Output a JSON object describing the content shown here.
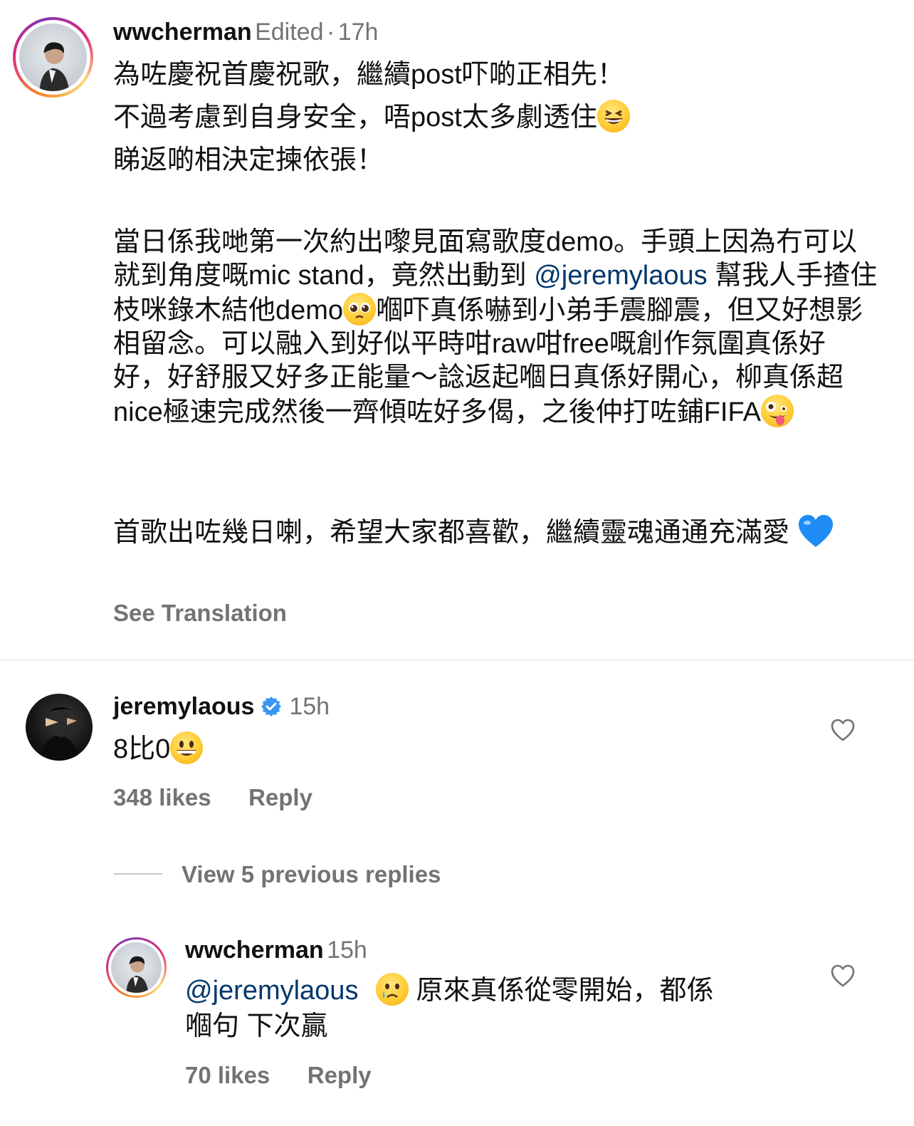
{
  "post": {
    "username": "wwcherman",
    "edited": "Edited",
    "separator": "·",
    "time": "17h",
    "line1": "為咗慶祝首慶祝歌，繼續post吓啲正相先！",
    "line2": "不過考慮到自身安全，唔post太多劇透住",
    "line3": "睇返啲相決定揀依張！",
    "para2_a": "當日係我哋第一次約出嚟見面寫歌度demo。手頭上因為冇可以就到角度嘅mic stand，竟然出動到 ",
    "para2_mention": "@jeremylaous",
    "para2_b": "幫我人手揸住枝咪錄木結他demo",
    "para2_c": "嗰吓真係嚇到小弟手震腳震，但又好想影相留念。可以融入到好似平時咁raw咁free嘅創作氛圍真係好好，好舒服又好多正能量～諗返起嗰日真係好開心，柳真係超nice極速完成然後一齊傾咗好多偈，之後仲打咗鋪FIFA",
    "para3": "首歌出咗幾日喇，希望大家都喜歡，繼續靈魂通通充滿愛",
    "see_translation": "See Translation"
  },
  "reply1": {
    "username": "jeremylaous",
    "time": "15h",
    "text": "8比0",
    "likes": "348 likes",
    "reply": "Reply"
  },
  "view_replies": "View 5 previous replies",
  "reply2": {
    "username": "wwcherman",
    "time": "15h",
    "mention": "@jeremylaous",
    "text_a": " 原來真係從零開始，都係",
    "text_b": "嗰句 下次贏",
    "likes": "70 likes",
    "reply": "Reply"
  },
  "colors": {
    "mention": "#00376b",
    "muted": "#737373",
    "verified": "#3897f0",
    "divider": "#dbdbdb"
  }
}
